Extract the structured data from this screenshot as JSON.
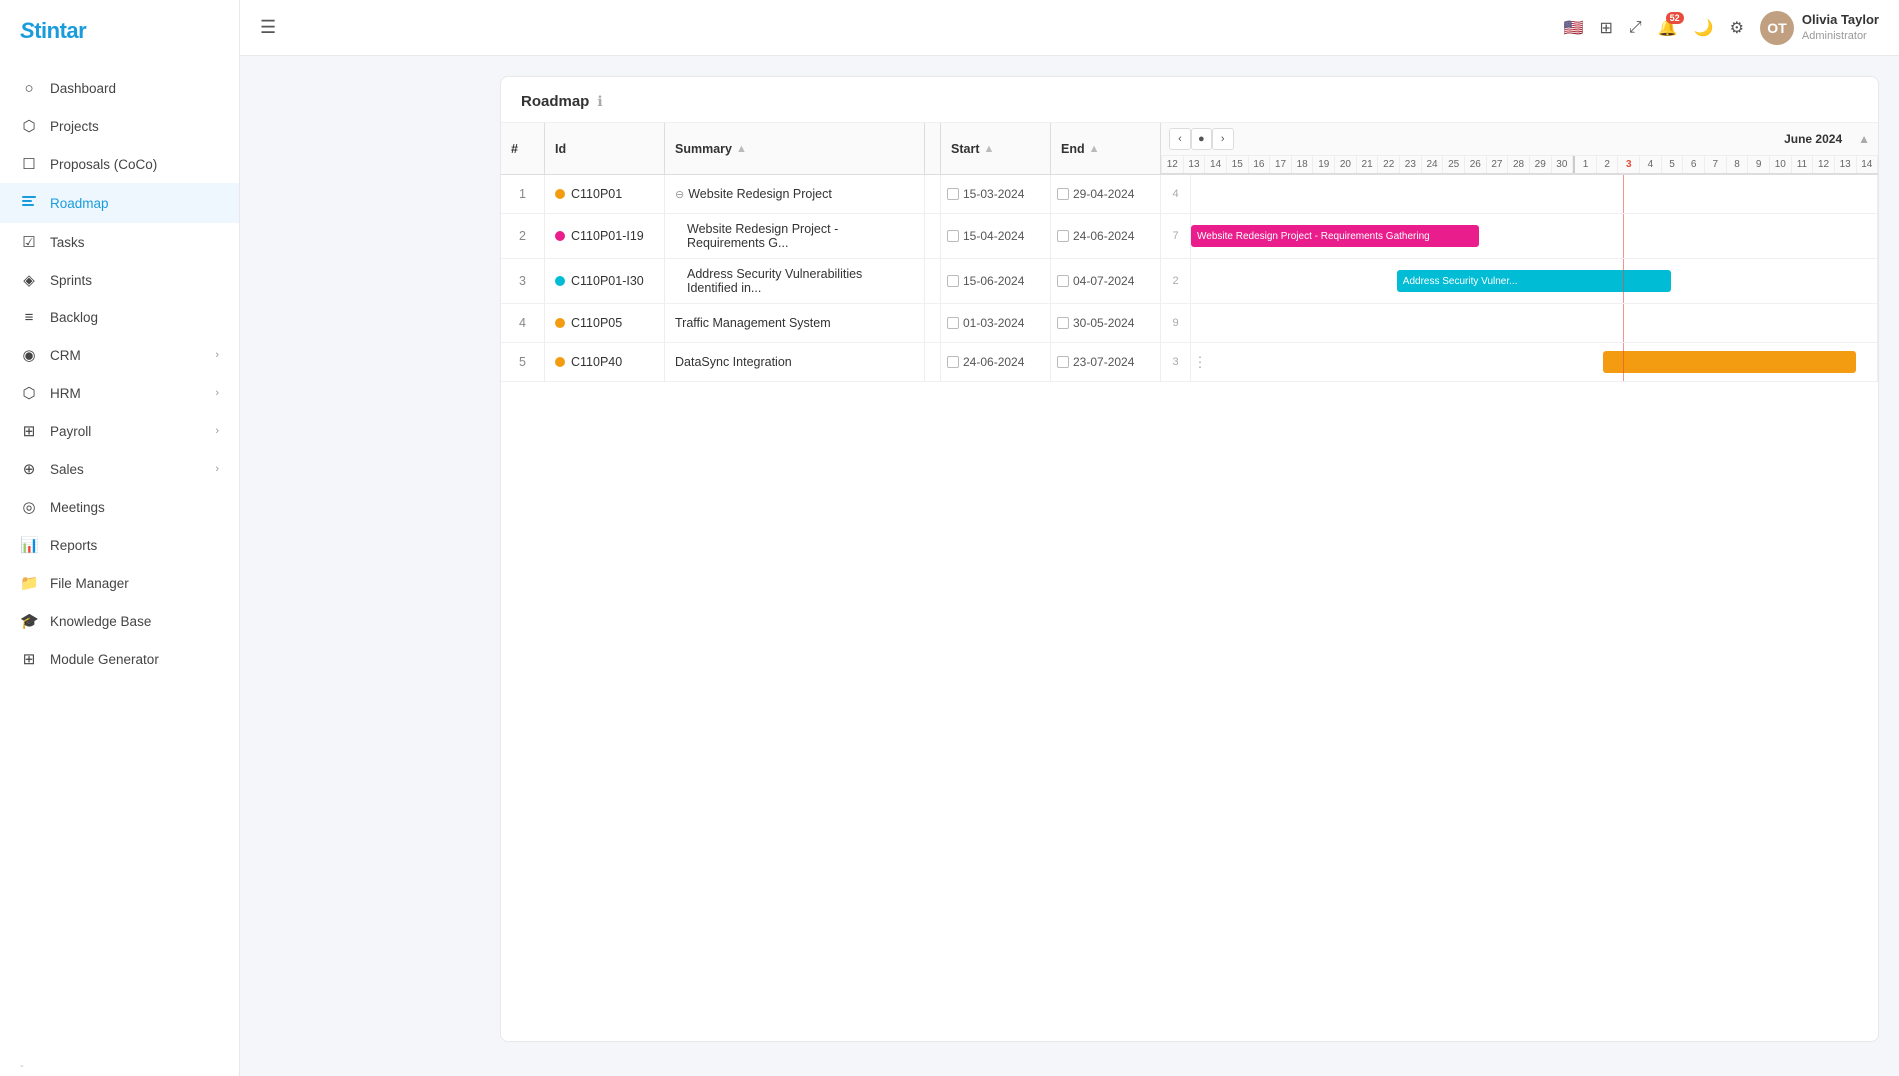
{
  "app": {
    "name": "Stintar"
  },
  "sidebar": {
    "items": [
      {
        "id": "dashboard",
        "label": "Dashboard",
        "icon": "⊙",
        "active": false,
        "hasChevron": false
      },
      {
        "id": "projects",
        "label": "Projects",
        "icon": "◫",
        "active": false,
        "hasChevron": false
      },
      {
        "id": "proposals",
        "label": "Proposals (CoCo)",
        "icon": "⊡",
        "active": false,
        "hasChevron": false
      },
      {
        "id": "roadmap",
        "label": "Roadmap",
        "icon": "⋯",
        "active": true,
        "hasChevron": false
      },
      {
        "id": "tasks",
        "label": "Tasks",
        "icon": "☑",
        "active": false,
        "hasChevron": false
      },
      {
        "id": "sprints",
        "label": "Sprints",
        "icon": "◈",
        "active": false,
        "hasChevron": false
      },
      {
        "id": "backlog",
        "label": "Backlog",
        "icon": "☰",
        "active": false,
        "hasChevron": false
      },
      {
        "id": "crm",
        "label": "CRM",
        "icon": "◉",
        "active": false,
        "hasChevron": true
      },
      {
        "id": "hrm",
        "label": "HRM",
        "icon": "⬡",
        "active": false,
        "hasChevron": true
      },
      {
        "id": "payroll",
        "label": "Payroll",
        "icon": "⊞",
        "active": false,
        "hasChevron": true
      },
      {
        "id": "sales",
        "label": "Sales",
        "icon": "⊕",
        "active": false,
        "hasChevron": true
      },
      {
        "id": "meetings",
        "label": "Meetings",
        "icon": "⊜",
        "active": false,
        "hasChevron": false
      },
      {
        "id": "reports",
        "label": "Reports",
        "icon": "⊞",
        "active": false,
        "hasChevron": false
      },
      {
        "id": "filemanager",
        "label": "File Manager",
        "icon": "📁",
        "active": false,
        "hasChevron": false
      },
      {
        "id": "knowledgebase",
        "label": "Knowledge Base",
        "icon": "🎓",
        "active": false,
        "hasChevron": false
      },
      {
        "id": "modulegenerator",
        "label": "Module Generator",
        "icon": "⊞",
        "active": false,
        "hasChevron": false
      }
    ]
  },
  "topbar": {
    "hamburger_label": "☰",
    "notification_count": "52",
    "user": {
      "name": "Olivia Taylor",
      "role": "Administrator",
      "initials": "OT"
    }
  },
  "roadmap": {
    "title": "Roadmap",
    "nav_month": "June 2024",
    "columns": {
      "num": "#",
      "id": "Id",
      "summary": "Summary",
      "start": "Start",
      "end": "End"
    },
    "rows": [
      {
        "num": "1",
        "id": "C110P01",
        "dot_color": "orange",
        "summary": "Website Redesign Project",
        "collapsible": true,
        "start": "15-03-2024",
        "end": "29-04-2024",
        "extra": "4",
        "bar": null
      },
      {
        "num": "2",
        "id": "C110P01-I19",
        "dot_color": "pink",
        "summary": "Website Redesign Project - Requirements G...",
        "collapsible": false,
        "indent": true,
        "start": "15-04-2024",
        "end": "24-06-2024",
        "extra": "7",
        "bar": {
          "color": "#e91e8c",
          "left_pct": 0,
          "width_pct": 42,
          "label": "Website Redesign Project - Requirements Gathering"
        }
      },
      {
        "num": "3",
        "id": "C110P01-I30",
        "dot_color": "cyan",
        "summary": "Address Security Vulnerabilities Identified in...",
        "collapsible": false,
        "indent": true,
        "start": "15-06-2024",
        "end": "04-07-2024",
        "extra": "2",
        "bar": {
          "color": "#00bcd4",
          "left_pct": 30,
          "width_pct": 40,
          "label": "Address Security Vulner..."
        }
      },
      {
        "num": "4",
        "id": "C110P05",
        "dot_color": "orange",
        "summary": "Traffic Management System",
        "collapsible": false,
        "start": "01-03-2024",
        "end": "30-05-2024",
        "extra": "9",
        "bar": null
      },
      {
        "num": "5",
        "id": "C110P40",
        "dot_color": "orange",
        "summary": "DataSync Integration",
        "collapsible": false,
        "start": "24-06-2024",
        "end": "23-07-2024",
        "extra": "3",
        "bar": {
          "color": "#f39c12",
          "left_pct": 60,
          "width_pct": 37,
          "label": ""
        }
      }
    ],
    "chart_dates": [
      "12",
      "13",
      "14",
      "15",
      "16",
      "17",
      "18",
      "19",
      "20",
      "21",
      "22",
      "23",
      "24",
      "25",
      "26",
      "27",
      "28",
      "29",
      "30",
      "1",
      "2",
      "3",
      "4",
      "5",
      "6",
      "7",
      "8",
      "9",
      "10",
      "11",
      "12",
      "13",
      "14"
    ]
  }
}
